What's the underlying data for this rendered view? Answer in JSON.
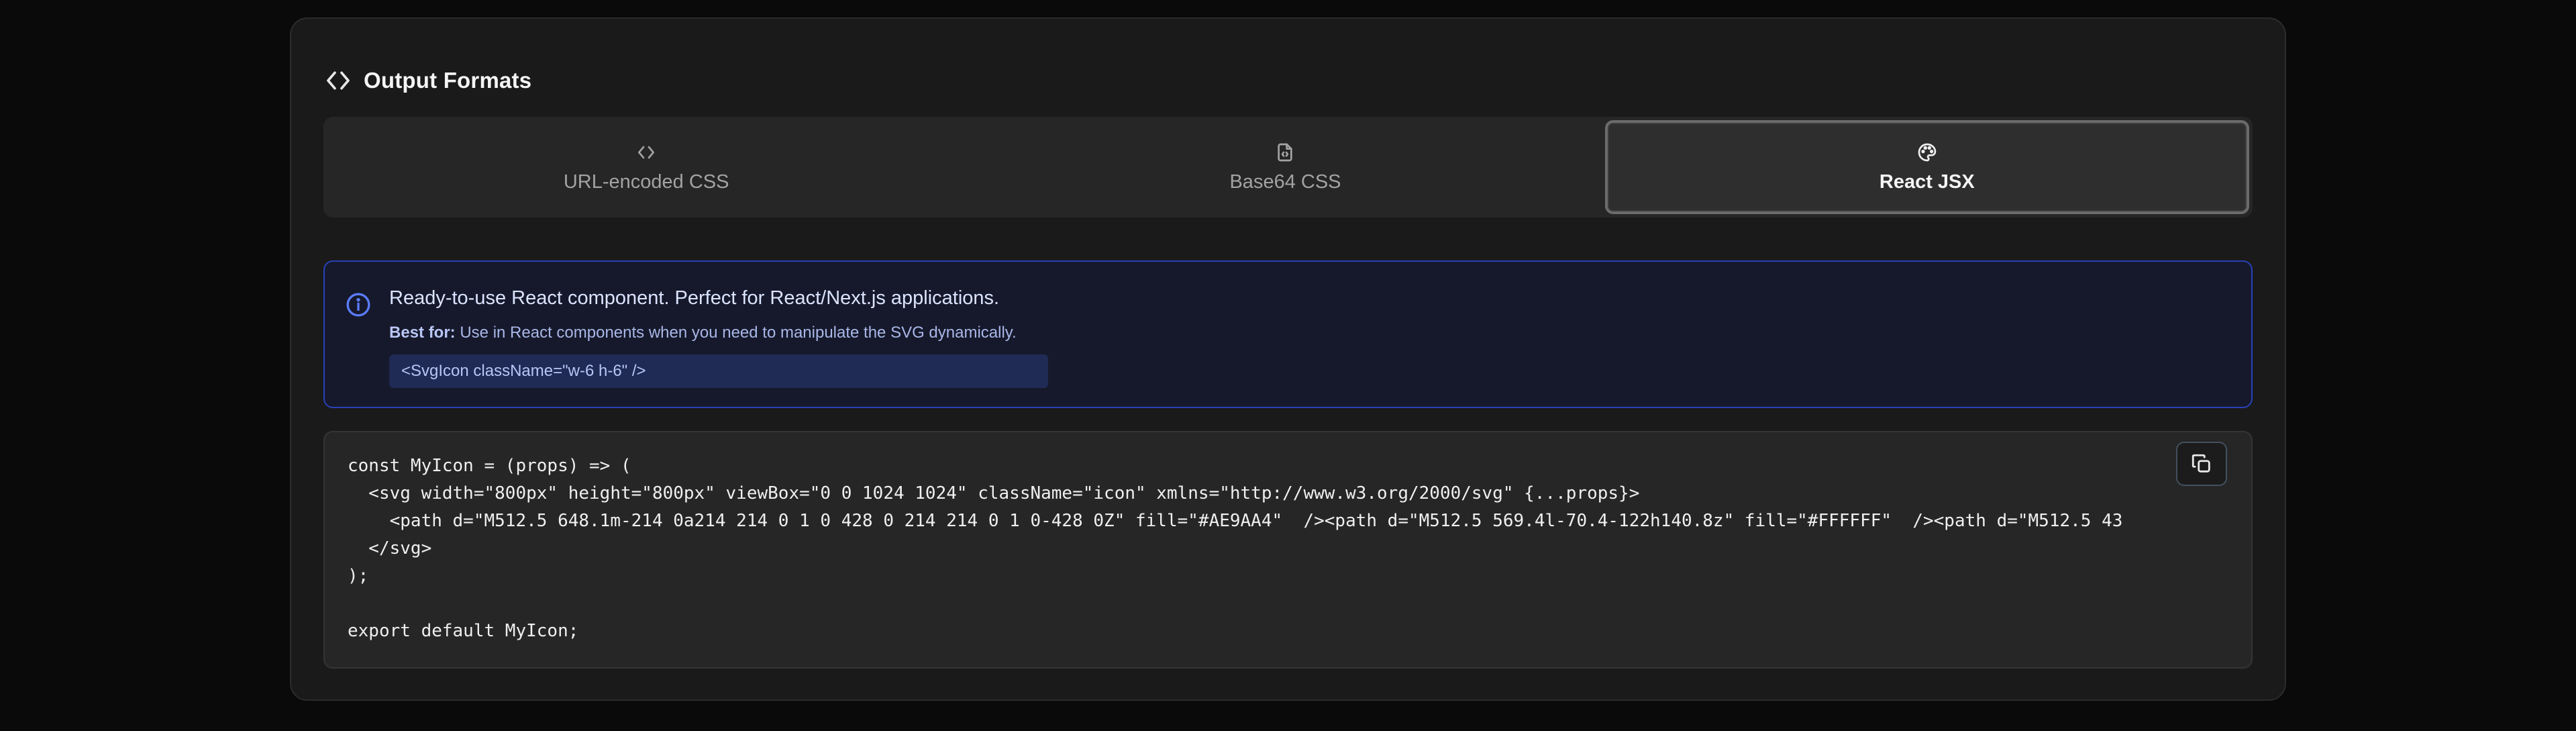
{
  "section": {
    "title": "Output Formats",
    "icon": "code-icon"
  },
  "tabs": [
    {
      "label": "URL-encoded CSS",
      "icon": "code-icon",
      "active": false
    },
    {
      "label": "Base64 CSS",
      "icon": "file-code-icon",
      "active": false
    },
    {
      "label": "React JSX",
      "icon": "palette-icon",
      "active": true
    }
  ],
  "info": {
    "title": "Ready-to-use React component. Perfect for React/Next.js applications.",
    "best_for_label": "Best for:",
    "best_for_text": "Use in React components when you need to manipulate the SVG dynamically.",
    "example": "<SvgIcon className=\"w-6 h-6\" />",
    "icon": "info-circle-icon"
  },
  "code": {
    "lines": [
      "const MyIcon = (props) => (",
      "  <svg width=\"800px\" height=\"800px\" viewBox=\"0 0 1024 1024\" className=\"icon\" xmlns=\"http://www.w3.org/2000/svg\" {...props}>",
      "    <path d=\"M512.5 648.1m-214 0a214 214 0 1 0 428 0 214 214 0 1 0-428 0Z\" fill=\"#AE9AA4\"  /><path d=\"M512.5 569.4l-70.4-122h140.8z\" fill=\"#FFFFFF\"  /><path d=\"M512.5 43",
      "  </svg>",
      ");",
      "",
      "export default MyIcon;"
    ],
    "copy_icon": "copy-icon"
  },
  "colors": {
    "background": "#0a0a0a",
    "card": "#1a1a1a",
    "info_border": "#2842b8",
    "info_bg": "#16192b",
    "accent_text": "#dbe4ff"
  }
}
